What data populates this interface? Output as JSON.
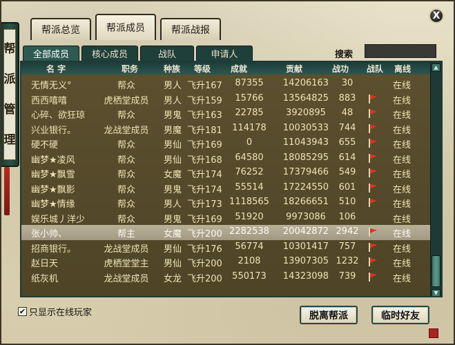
{
  "sidebar_banner": [
    "帮",
    "派",
    "管",
    "理"
  ],
  "top_tabs": [
    {
      "label": "帮派总览"
    },
    {
      "label": "帮派成员",
      "active": true
    },
    {
      "label": "帮派战报"
    }
  ],
  "sub_tabs": [
    {
      "label": "全部成员",
      "active": true
    },
    {
      "label": "核心成员"
    },
    {
      "label": "战队"
    },
    {
      "label": "申请人"
    }
  ],
  "search": {
    "label": "搜索",
    "value": ""
  },
  "columns": [
    "名 字",
    "职务",
    "种族",
    "等级",
    "成就",
    "贡献",
    "战功",
    "战队",
    "离线"
  ],
  "rows": [
    {
      "name": "无情无义°",
      "role": "帮众",
      "race": "男人",
      "level": "飞升167",
      "achieve": "87355",
      "contrib": "14206163",
      "merit": "30",
      "team": false,
      "status": "在线"
    },
    {
      "name": "西西嘻嘻",
      "role": "虎栖堂成员",
      "race": "男人",
      "level": "飞升159",
      "achieve": "15766",
      "contrib": "13564825",
      "merit": "883",
      "team": true,
      "status": "在线"
    },
    {
      "name": "心碎、欲狂琼",
      "role": "帮众",
      "race": "男鬼",
      "level": "飞升163",
      "achieve": "22785",
      "contrib": "3920895",
      "merit": "48",
      "team": true,
      "status": "在线"
    },
    {
      "name": "兴业银行。",
      "role": "龙战堂成员",
      "race": "男魔",
      "level": "飞升181",
      "achieve": "114178",
      "contrib": "10030533",
      "merit": "744",
      "team": true,
      "status": "在线"
    },
    {
      "name": "硬不硬",
      "role": "帮众",
      "race": "男仙",
      "level": "飞升169",
      "achieve": "0",
      "contrib": "11043943",
      "merit": "655",
      "team": true,
      "status": "在线"
    },
    {
      "name": "幽梦★凌风",
      "role": "帮众",
      "race": "男仙",
      "level": "飞升168",
      "achieve": "64580",
      "contrib": "18085295",
      "merit": "614",
      "team": true,
      "status": "在线"
    },
    {
      "name": "幽梦★飘雪",
      "role": "帮众",
      "race": "女魔",
      "level": "飞升174",
      "achieve": "76252",
      "contrib": "17379466",
      "merit": "549",
      "team": true,
      "status": "在线"
    },
    {
      "name": "幽梦★飘影",
      "role": "帮众",
      "race": "男鬼",
      "level": "飞升174",
      "achieve": "55514",
      "contrib": "17224550",
      "merit": "601",
      "team": true,
      "status": "在线"
    },
    {
      "name": "幽梦★情缘",
      "role": "帮众",
      "race": "男人",
      "level": "飞升173",
      "achieve": "1118565",
      "contrib": "18266651",
      "merit": "510",
      "team": true,
      "status": "在线"
    },
    {
      "name": "娱乐城丿洋少",
      "role": "帮众",
      "race": "男鬼",
      "level": "飞升169",
      "achieve": "51920",
      "contrib": "9973086",
      "merit": "106",
      "team": false,
      "status": "在线"
    },
    {
      "name": "张小帅、",
      "role": "帮主",
      "race": "女魔",
      "level": "飞升200",
      "achieve": "2282538",
      "contrib": "20042872",
      "merit": "2942",
      "team": true,
      "status": "在线",
      "selected": true
    },
    {
      "name": "招商银行。",
      "role": "龙战堂成员",
      "race": "男仙",
      "level": "飞升176",
      "achieve": "56774",
      "contrib": "10301417",
      "merit": "757",
      "team": true,
      "status": "在线"
    },
    {
      "name": "赵日天",
      "role": "虎栖堂堂主",
      "race": "男仙",
      "level": "飞升200",
      "achieve": "2108",
      "contrib": "13907305",
      "merit": "1232",
      "team": true,
      "status": "在线"
    },
    {
      "name": "纸灰机",
      "role": "龙战堂成员",
      "race": "女龙",
      "level": "飞升200",
      "achieve": "550173",
      "contrib": "14323098",
      "merit": "739",
      "team": true,
      "status": "在线"
    }
  ],
  "online_only": {
    "label": "只显示在线玩家",
    "checked": true
  },
  "buttons": {
    "leave": "脱离帮派",
    "temp_friend": "临时好友"
  },
  "close": "X",
  "colors": {
    "accent": "#1f3f3a",
    "flag": "#d8371f",
    "row_text": "#efe3b6"
  }
}
